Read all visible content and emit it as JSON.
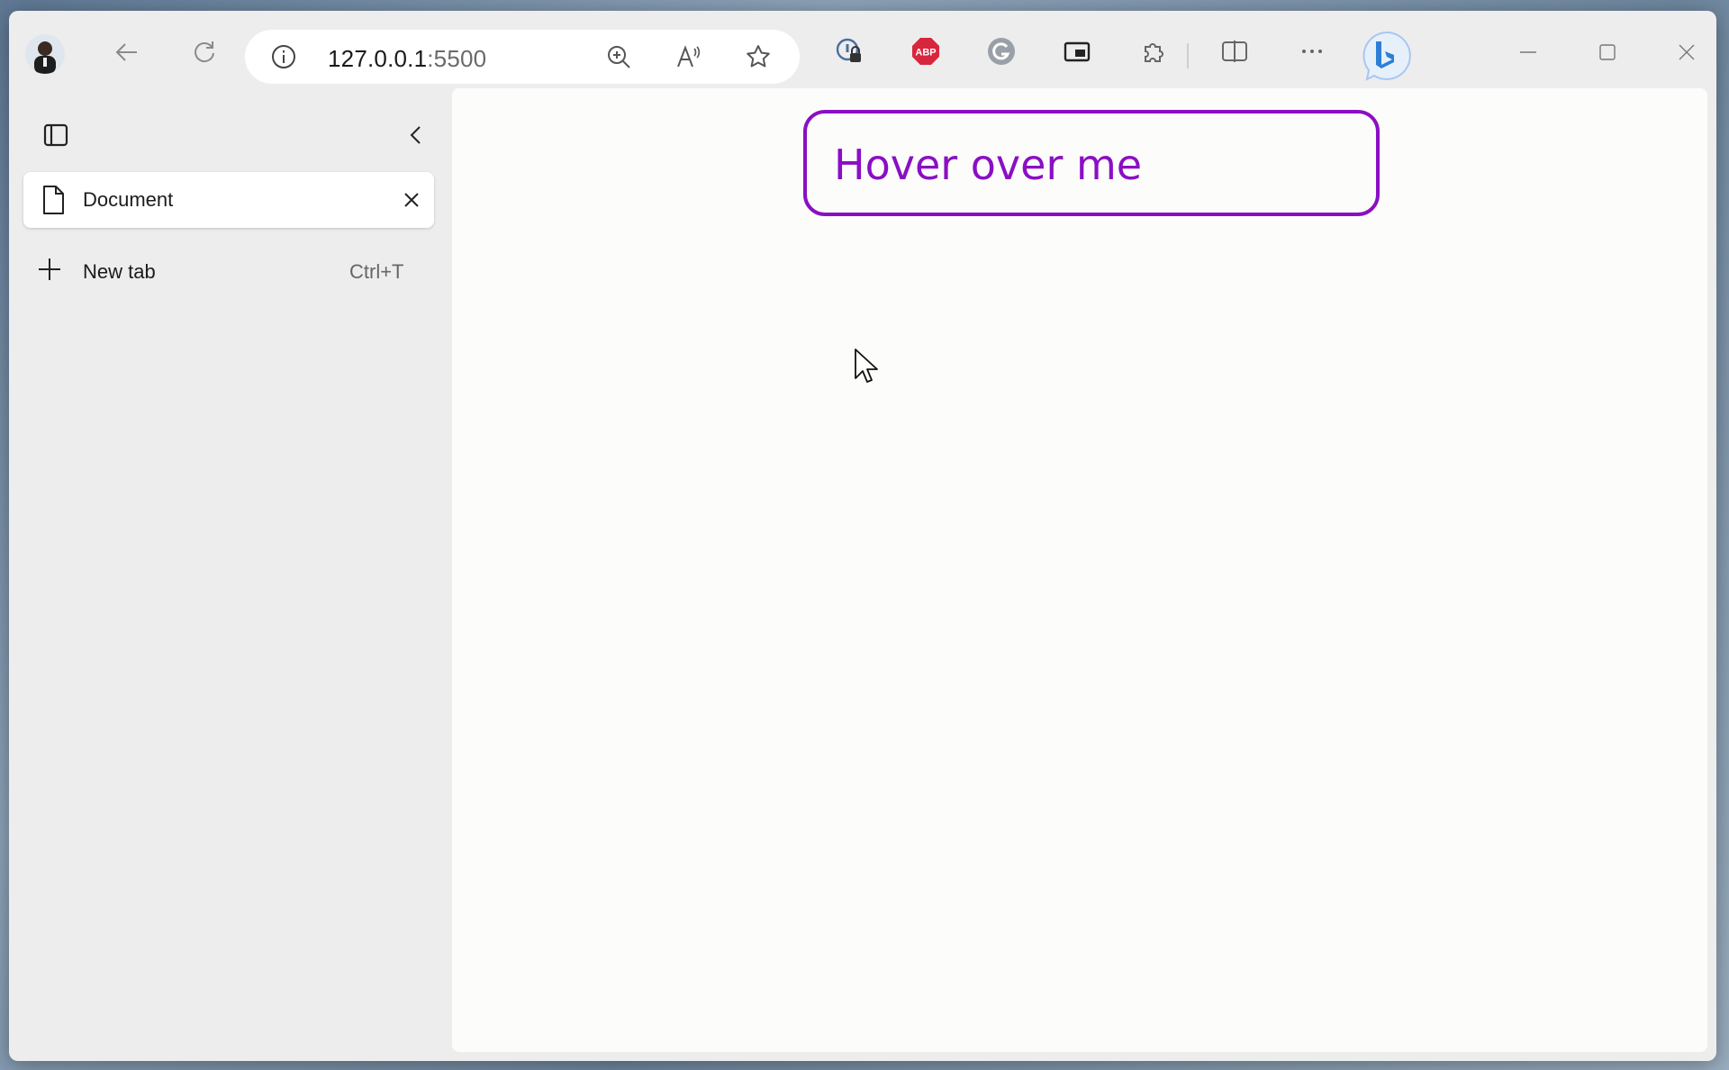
{
  "browser": {
    "address": {
      "host": "127.0.0.1",
      "port": ":5500"
    }
  },
  "sidebar": {
    "tabs": [
      {
        "label": "Document"
      }
    ],
    "new_tab": {
      "label": "New tab",
      "shortcut": "Ctrl+T"
    }
  },
  "page": {
    "hover_box_text": "Hover over me"
  },
  "colors": {
    "accent": "#8a0fc4",
    "abp_red": "#d7263d",
    "bing_blue": "#2b7fd6"
  },
  "icons": [
    "avatar",
    "back-arrow-icon",
    "refresh-icon",
    "info-icon",
    "zoom-in-icon",
    "read-aloud-icon",
    "favorite-star-icon",
    "password-lock-icon",
    "adblock-icon",
    "grammarly-icon",
    "picture-in-picture-icon",
    "extensions-icon",
    "split-screen-icon",
    "more-icon",
    "bing-copilot-icon",
    "minimize-icon",
    "maximize-icon",
    "close-icon",
    "sidebar-panel-icon",
    "collapse-chevron-icon",
    "document-icon",
    "tab-close-icon",
    "plus-icon"
  ]
}
